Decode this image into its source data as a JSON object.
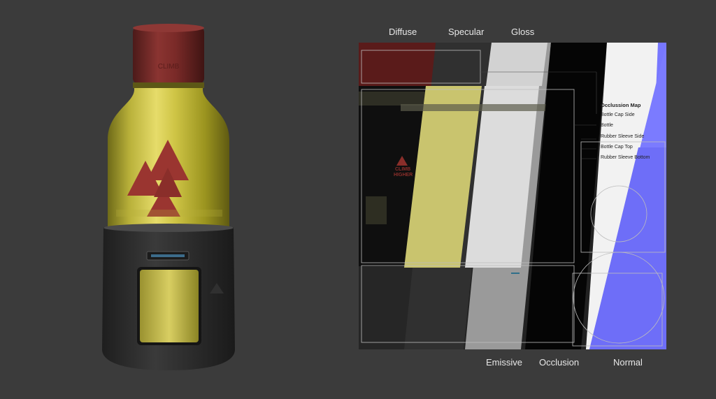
{
  "channel_labels_top": [
    "Diffuse",
    "Specular",
    "Gloss"
  ],
  "channel_labels_bottom": [
    "Emissive",
    "Occlusion",
    "Normal"
  ],
  "atlas_labels": {
    "title": "Occlussion Map",
    "items": [
      "Bottle Cap Side",
      "Bottle",
      "Rubber Sleeve Side",
      "Bottle Cap Top",
      "Rubber Sleeve Bottom"
    ]
  },
  "colors": {
    "background": "#3b3b3b",
    "gold": "#c9c23c",
    "cap_red": "#7a2a28",
    "logo_red": "#9a3530",
    "sleeve": "#2a2a2a",
    "normal_blue": "#7777ff"
  },
  "logo_text": [
    "CLIMB",
    "HIGHER"
  ]
}
